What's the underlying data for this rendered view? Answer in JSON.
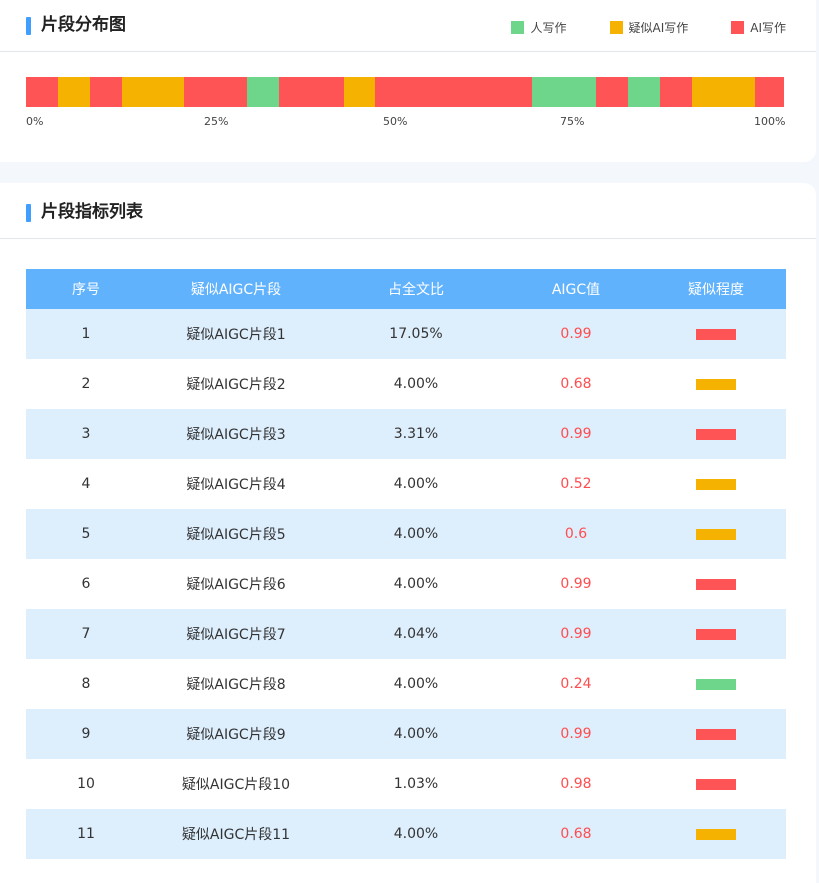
{
  "distribution": {
    "title": "片段分布图",
    "legend": [
      {
        "label": "人写作",
        "color": "#6ed68b"
      },
      {
        "label": "疑似AI写作",
        "color": "#f5b200"
      },
      {
        "label": "AI写作",
        "color": "#ff5455"
      }
    ],
    "axis_labels": [
      "0%",
      "25%",
      "50%",
      "75%",
      "100%"
    ],
    "segments": [
      {
        "percent": 4.2,
        "type": "ai"
      },
      {
        "percent": 4.2,
        "type": "suspected"
      },
      {
        "percent": 4.2,
        "type": "ai"
      },
      {
        "percent": 8.3,
        "type": "suspected"
      },
      {
        "percent": 8.3,
        "type": "ai"
      },
      {
        "percent": 4.2,
        "type": "human"
      },
      {
        "percent": 8.5,
        "type": "ai"
      },
      {
        "percent": 4.1,
        "type": "suspected"
      },
      {
        "percent": 20.8,
        "type": "ai"
      },
      {
        "percent": 8.4,
        "type": "human"
      },
      {
        "percent": 4.2,
        "type": "ai"
      },
      {
        "percent": 4.2,
        "type": "human"
      },
      {
        "percent": 4.2,
        "type": "ai"
      },
      {
        "percent": 8.4,
        "type": "suspected"
      },
      {
        "percent": 3.8,
        "type": "ai"
      }
    ]
  },
  "list": {
    "title": "片段指标列表",
    "columns": [
      "序号",
      "疑似AIGC片段",
      "占全文比",
      "AIGC值",
      "疑似程度"
    ],
    "rows": [
      {
        "index": "1",
        "segment": "疑似AIGC片段1",
        "ratio": "17.05%",
        "aigc": "0.99",
        "level": "ai"
      },
      {
        "index": "2",
        "segment": "疑似AIGC片段2",
        "ratio": "4.00%",
        "aigc": "0.68",
        "level": "suspected"
      },
      {
        "index": "3",
        "segment": "疑似AIGC片段3",
        "ratio": "3.31%",
        "aigc": "0.99",
        "level": "ai"
      },
      {
        "index": "4",
        "segment": "疑似AIGC片段4",
        "ratio": "4.00%",
        "aigc": "0.52",
        "level": "suspected"
      },
      {
        "index": "5",
        "segment": "疑似AIGC片段5",
        "ratio": "4.00%",
        "aigc": "0.6",
        "level": "suspected"
      },
      {
        "index": "6",
        "segment": "疑似AIGC片段6",
        "ratio": "4.00%",
        "aigc": "0.99",
        "level": "ai"
      },
      {
        "index": "7",
        "segment": "疑似AIGC片段7",
        "ratio": "4.04%",
        "aigc": "0.99",
        "level": "ai"
      },
      {
        "index": "8",
        "segment": "疑似AIGC片段8",
        "ratio": "4.00%",
        "aigc": "0.24",
        "level": "human"
      },
      {
        "index": "9",
        "segment": "疑似AIGC片段9",
        "ratio": "4.00%",
        "aigc": "0.99",
        "level": "ai"
      },
      {
        "index": "10",
        "segment": "疑似AIGC片段10",
        "ratio": "1.03%",
        "aigc": "0.98",
        "level": "ai"
      },
      {
        "index": "11",
        "segment": "疑似AIGC片段11",
        "ratio": "4.00%",
        "aigc": "0.68",
        "level": "suspected"
      }
    ]
  },
  "colors": {
    "human": "#6ed68b",
    "suspected": "#f5b200",
    "ai": "#ff5455",
    "accent": "#409eff",
    "table_header": "#61b2fd"
  }
}
